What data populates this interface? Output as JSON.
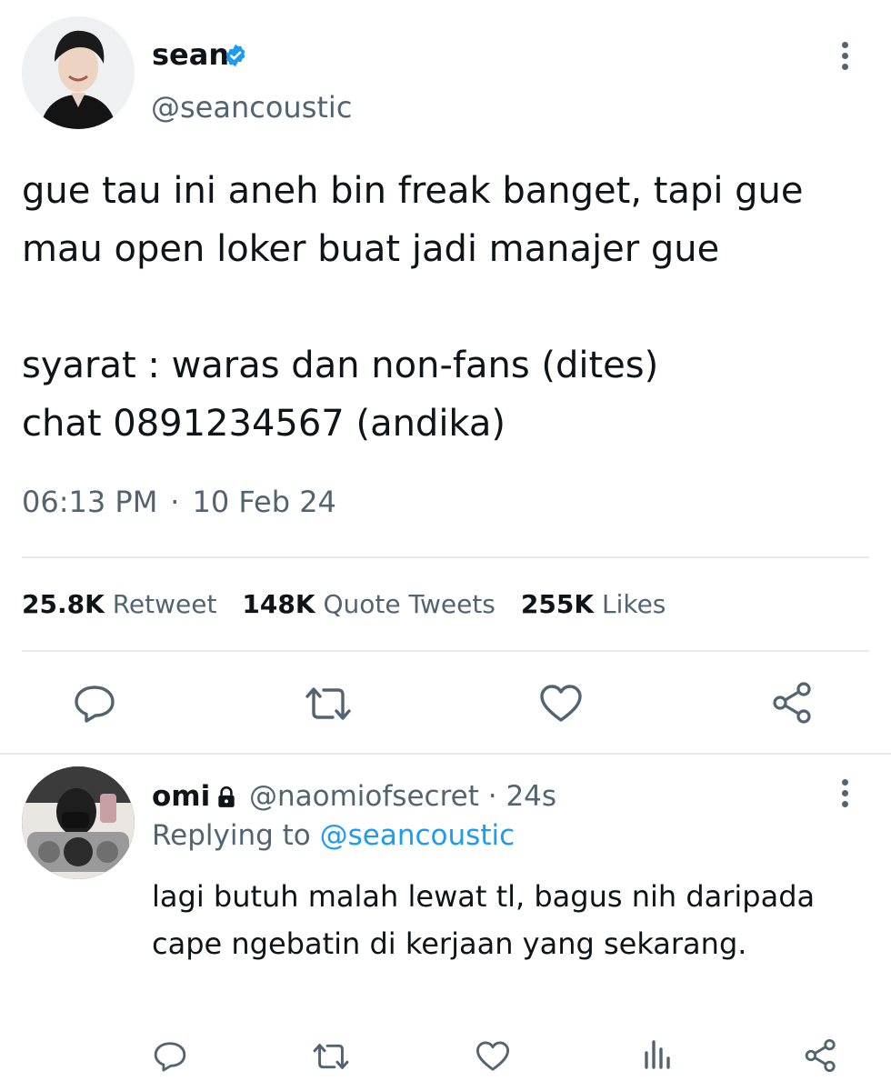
{
  "tweet": {
    "author_name": "sean",
    "author_handle": "@seancoustic",
    "verified": true,
    "text": "gue tau ini aneh bin freak banget, tapi gue\nmau open loker buat jadi manajer gue\n\nsyarat : waras dan non-fans (dites)\nchat 0891234567 (andika)",
    "time": "06:13 PM",
    "separator": "·",
    "date": "10 Feb 24",
    "stats": {
      "retweets_count": "25.8K",
      "retweets_label": "Retweet",
      "quotes_count": "148K",
      "quotes_label": "Quote Tweets",
      "likes_count": "255K",
      "likes_label": "Likes"
    },
    "actions": [
      "reply-icon",
      "retweet-icon",
      "like-icon",
      "share-icon"
    ]
  },
  "reply": {
    "author_name": "omi",
    "protected": true,
    "author_handle": "@naomiofsecret",
    "separator": "·",
    "age": "24s",
    "replying_prefix": "Replying to",
    "replying_to": "@seancoustic",
    "text": "lagi butuh malah lewat tl, bagus nih daripada cape ngebatin di kerjaan yang sekarang.",
    "actions": [
      "reply-icon",
      "retweet-icon",
      "like-icon",
      "analytics-icon",
      "share-icon"
    ]
  },
  "colors": {
    "text": "#0f1419",
    "muted": "#536471",
    "accent": "#1d9bf0",
    "divider": "#e7e9ec"
  }
}
